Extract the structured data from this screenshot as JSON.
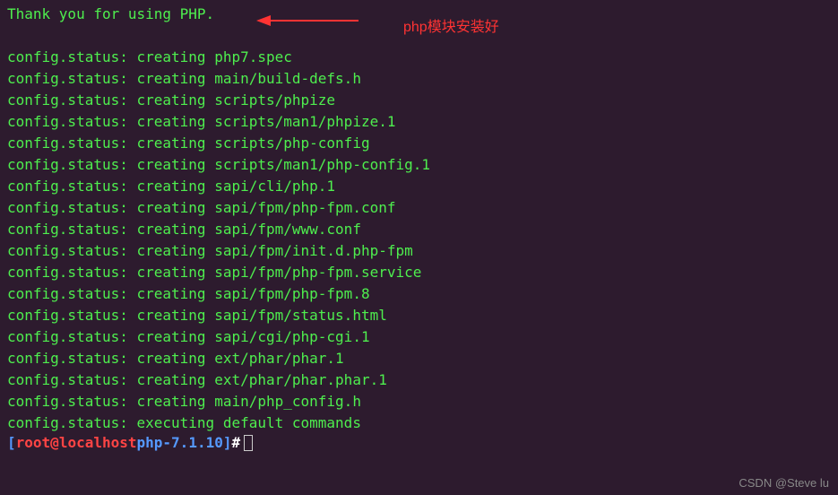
{
  "thank_you": "Thank you for using PHP.",
  "annotation": "php模块安装好",
  "lines": [
    "config.status: creating php7.spec",
    "config.status: creating main/build-defs.h",
    "config.status: creating scripts/phpize",
    "config.status: creating scripts/man1/phpize.1",
    "config.status: creating scripts/php-config",
    "config.status: creating scripts/man1/php-config.1",
    "config.status: creating sapi/cli/php.1",
    "config.status: creating sapi/fpm/php-fpm.conf",
    "config.status: creating sapi/fpm/www.conf",
    "config.status: creating sapi/fpm/init.d.php-fpm",
    "config.status: creating sapi/fpm/php-fpm.service",
    "config.status: creating sapi/fpm/php-fpm.8",
    "config.status: creating sapi/fpm/status.html",
    "config.status: creating sapi/cgi/php-cgi.1",
    "config.status: creating ext/phar/phar.1",
    "config.status: creating ext/phar/phar.phar.1",
    "config.status: creating main/php_config.h",
    "config.status: executing default commands"
  ],
  "prompt": {
    "open_bracket": "[",
    "user": "root",
    "at": "@",
    "host": "localhost",
    "space": " ",
    "path": "php-7.1.10",
    "close_bracket": "]",
    "hash": "#"
  },
  "watermark": "CSDN @Steve lu"
}
